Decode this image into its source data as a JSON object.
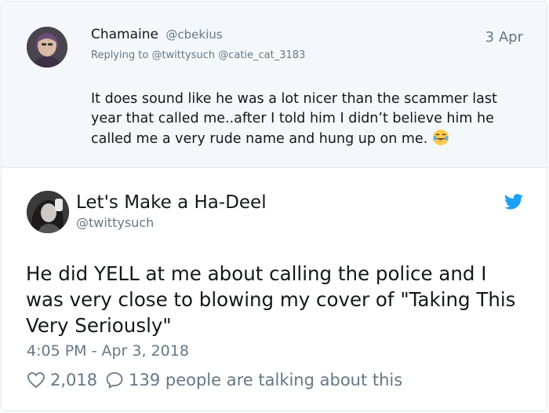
{
  "reply": {
    "author_name": "Chamaine",
    "author_handle": "@cbekius",
    "date": "3 Apr",
    "replying_to_prefix": "Replying to",
    "replying_to_handles": [
      "@twittysuch",
      "@catie_cat_3183"
    ],
    "text": "It does sound like he was a lot nicer than the scammer last year that called me..after I told him I didn’t believe him he called me a  very rude name and hung up on me.",
    "emoji": "face-with-tears-of-joy"
  },
  "tweet": {
    "author_name": "Let's Make a Ha-Deel",
    "author_handle": "@twittysuch",
    "text": "He did YELL at me about calling the police and I was very close to blowing my cover of \"Taking This Very Seriously\"",
    "timestamp": "4:05 PM - Apr 3, 2018",
    "likes": "2,018",
    "conversation": "139 people are talking about this"
  },
  "colors": {
    "twitter_blue": "#1da1f2",
    "text_primary": "#14171a",
    "text_secondary": "#657786",
    "reply_background": "#f5f8fa"
  }
}
